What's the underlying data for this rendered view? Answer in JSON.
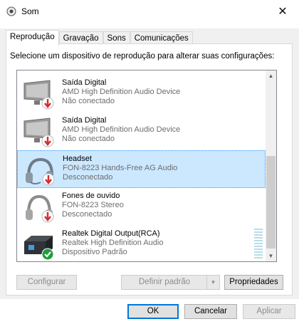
{
  "window": {
    "title": "Som",
    "close_glyph": "✕"
  },
  "tabs": [
    {
      "label": "Reprodução",
      "active": true
    },
    {
      "label": "Gravação",
      "active": false
    },
    {
      "label": "Sons",
      "active": false
    },
    {
      "label": "Comunicações",
      "active": false
    }
  ],
  "instruction": "Selecione um dispositivo de reprodução para alterar suas configurações:",
  "devices": [
    {
      "name": "Saída Digital",
      "driver": "AMD High Definition Audio Device",
      "status": "Não conectado",
      "icon": "monitor-speaker-icon",
      "badge": "red-down-arrow"
    },
    {
      "name": "Saída Digital",
      "driver": "AMD High Definition Audio Device",
      "status": "Não conectado",
      "icon": "monitor-speaker-icon",
      "badge": "red-down-arrow"
    },
    {
      "name": "Headset",
      "driver": "FON-8223 Hands-Free AG Audio",
      "status": "Desconectado",
      "icon": "headset-icon",
      "badge": "red-down-arrow",
      "selected": true
    },
    {
      "name": "Fones de ouvido",
      "driver": "FON-8223 Stereo",
      "status": "Desconectado",
      "icon": "headphones-icon",
      "badge": "red-down-arrow"
    },
    {
      "name": "Realtek Digital Output(RCA)",
      "driver": "Realtek High Definition Audio",
      "status": "Dispositivo Padrão",
      "icon": "digital-output-icon",
      "badge": "green-check"
    }
  ],
  "buttons": {
    "configure": "Configurar",
    "set_default": "Definir padrão",
    "properties": "Propriedades",
    "ok": "OK",
    "cancel": "Cancelar",
    "apply": "Aplicar"
  },
  "colors": {
    "accent": "#0078d7",
    "selection_bg": "#cce8ff",
    "status_red": "#d32f2f",
    "status_green": "#1e9e3c"
  }
}
